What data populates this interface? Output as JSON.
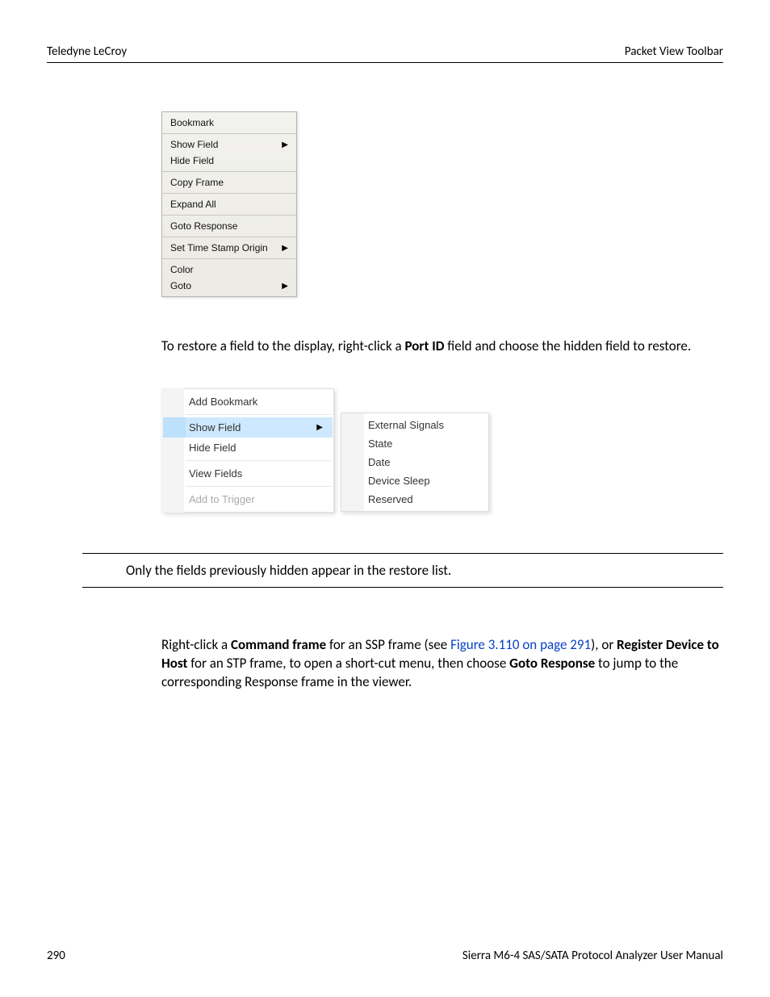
{
  "header": {
    "left": "Teledyne LeCroy",
    "right": "Packet View Toolbar"
  },
  "menu1": {
    "items": [
      {
        "label": "Bookmark",
        "submenu": false,
        "sep_after": true
      },
      {
        "label": "Show Field",
        "submenu": true,
        "sep_after": false
      },
      {
        "label": "Hide Field",
        "submenu": false,
        "sep_after": true
      },
      {
        "label": "Copy Frame",
        "submenu": false,
        "sep_after": true
      },
      {
        "label": "Expand All",
        "submenu": false,
        "sep_after": true
      },
      {
        "label": "Goto Response",
        "submenu": false,
        "sep_after": true
      },
      {
        "label": "Set Time Stamp Origin",
        "submenu": true,
        "sep_after": true
      },
      {
        "label": "Color",
        "submenu": false,
        "sep_after": false
      },
      {
        "label": "Goto",
        "submenu": true,
        "sep_after": false
      }
    ]
  },
  "paragraph1": {
    "prefix": "To restore a field to the display, right-click a ",
    "bold": "Port ID",
    "suffix": " field and choose the hidden field to restore."
  },
  "menu2": {
    "items": [
      {
        "label": "Add Bookmark",
        "submenu": false,
        "sep_after": true,
        "state": ""
      },
      {
        "label": "Show Field",
        "submenu": true,
        "sep_after": false,
        "state": "highlight"
      },
      {
        "label": "Hide Field",
        "submenu": false,
        "sep_after": true,
        "state": ""
      },
      {
        "label": "View Fields",
        "submenu": false,
        "sep_after": true,
        "state": ""
      },
      {
        "label": "Add to Trigger",
        "submenu": false,
        "sep_after": false,
        "state": "disabled"
      }
    ]
  },
  "submenu": {
    "items": [
      {
        "label": "External Signals"
      },
      {
        "label": "State"
      },
      {
        "label": "Date"
      },
      {
        "label": "Device Sleep"
      },
      {
        "label": "Reserved"
      }
    ]
  },
  "note": "Only the fields previously hidden appear in the restore list.",
  "paragraph2": {
    "t1": "Right-click a ",
    "b1": "Command frame",
    "t2": " for an SSP frame (see ",
    "link": "Figure 3.110 on page 291",
    "t3": "), or ",
    "b2": "Register Device to Host",
    "t4": " for an STP frame, to open a short-cut menu, then choose ",
    "b3": "Goto Response",
    "t5": " to jump to the corresponding Response frame in the viewer."
  },
  "footer": {
    "page": "290",
    "title": "Sierra M6-4 SAS/SATA Protocol Analyzer User Manual"
  },
  "glyphs": {
    "arrow": "▶"
  }
}
